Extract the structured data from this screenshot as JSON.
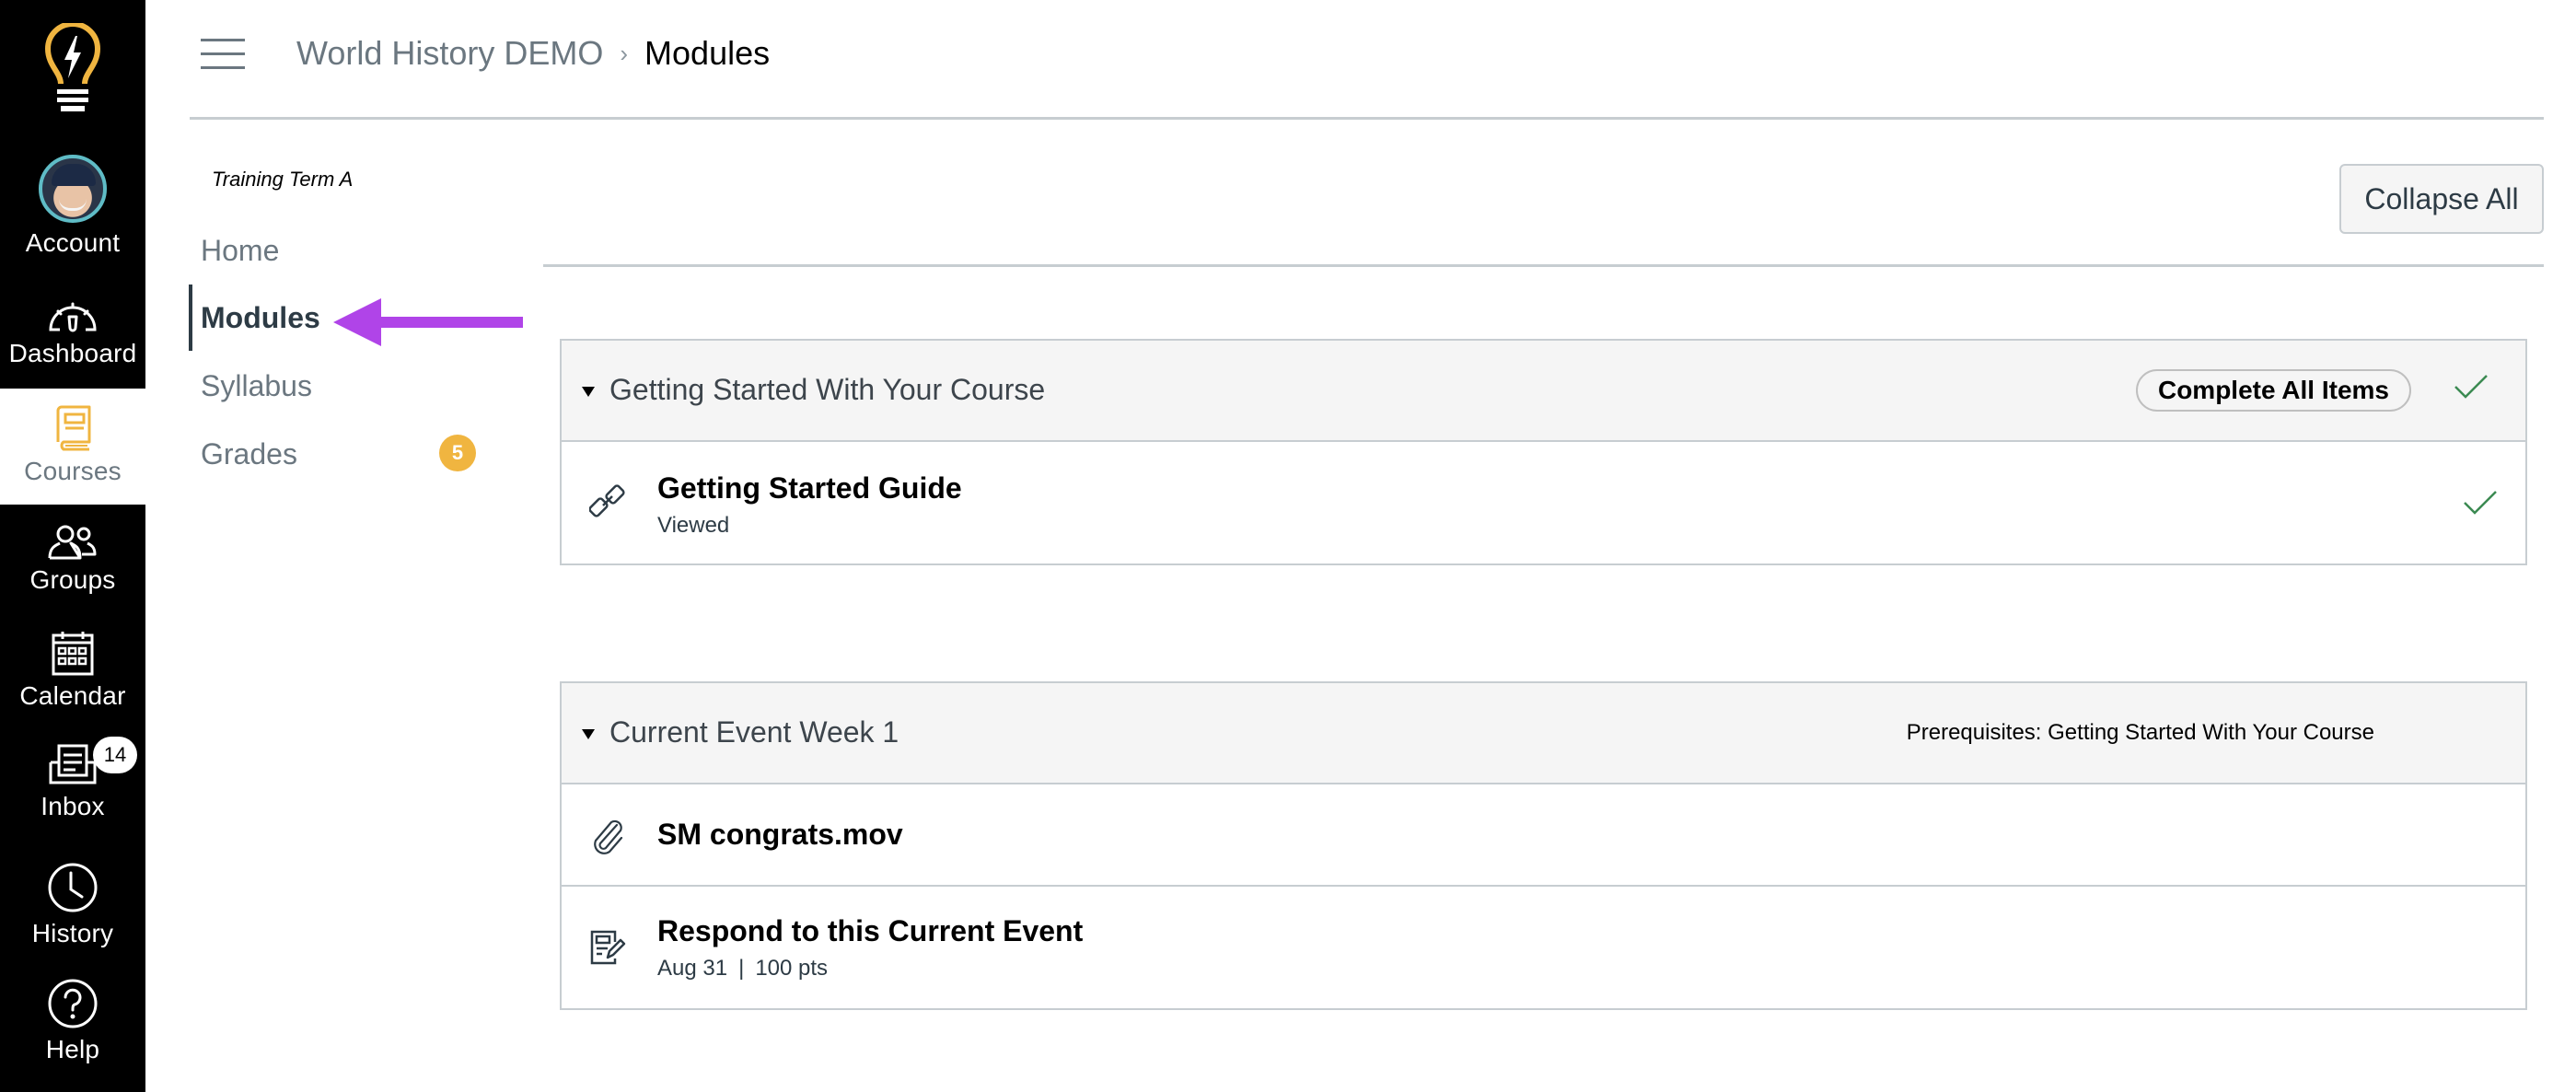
{
  "global_nav": {
    "logo_icon": "lightbulb-bolt-logo",
    "items": [
      {
        "label": "Account",
        "icon": "avatar",
        "active": false
      },
      {
        "label": "Dashboard",
        "icon": "speedometer-icon",
        "active": false
      },
      {
        "label": "Courses",
        "icon": "book-icon",
        "active": true
      },
      {
        "label": "Groups",
        "icon": "people-icon",
        "active": false
      },
      {
        "label": "Calendar",
        "icon": "calendar-icon",
        "active": false
      },
      {
        "label": "Inbox",
        "icon": "inbox-icon",
        "active": false,
        "badge": "14"
      },
      {
        "label": "History",
        "icon": "clock-icon",
        "active": false
      },
      {
        "label": "Help",
        "icon": "question-circle-icon",
        "active": false
      }
    ],
    "colors": {
      "background": "#000000",
      "accent": "#f0b540",
      "avatar_ring": "#5fbcc6"
    }
  },
  "header": {
    "menu_icon": "hamburger-icon",
    "breadcrumb": {
      "course": "World History DEMO",
      "separator": "›",
      "current": "Modules"
    }
  },
  "course_nav": {
    "term": "Training Term A",
    "items": [
      {
        "label": "Home",
        "active": false
      },
      {
        "label": "Modules",
        "active": true
      },
      {
        "label": "Syllabus",
        "active": false
      },
      {
        "label": "Grades",
        "active": false,
        "badge": "5"
      }
    ],
    "badge_color": "#f0b540"
  },
  "annotation": {
    "type": "arrow",
    "points_to": "Modules",
    "color": "#b044e8"
  },
  "toolbar": {
    "collapse_all_label": "Collapse All"
  },
  "modules": [
    {
      "title": "Getting Started With Your Course",
      "complete_all_label": "Complete All Items",
      "completed": true,
      "items": [
        {
          "icon": "link-icon",
          "title": "Getting Started Guide",
          "meta": "Viewed",
          "completed": true
        }
      ]
    },
    {
      "title": "Current Event Week 1",
      "prerequisites": "Prerequisites: Getting Started With Your Course",
      "items": [
        {
          "icon": "paperclip-icon",
          "title": "SM congrats.mov"
        },
        {
          "icon": "assignment-icon",
          "title": "Respond to this Current Event",
          "due": "Aug 31",
          "separator": "|",
          "points": "100 pts"
        }
      ]
    }
  ],
  "status_colors": {
    "complete_check": "#3b8a52"
  }
}
